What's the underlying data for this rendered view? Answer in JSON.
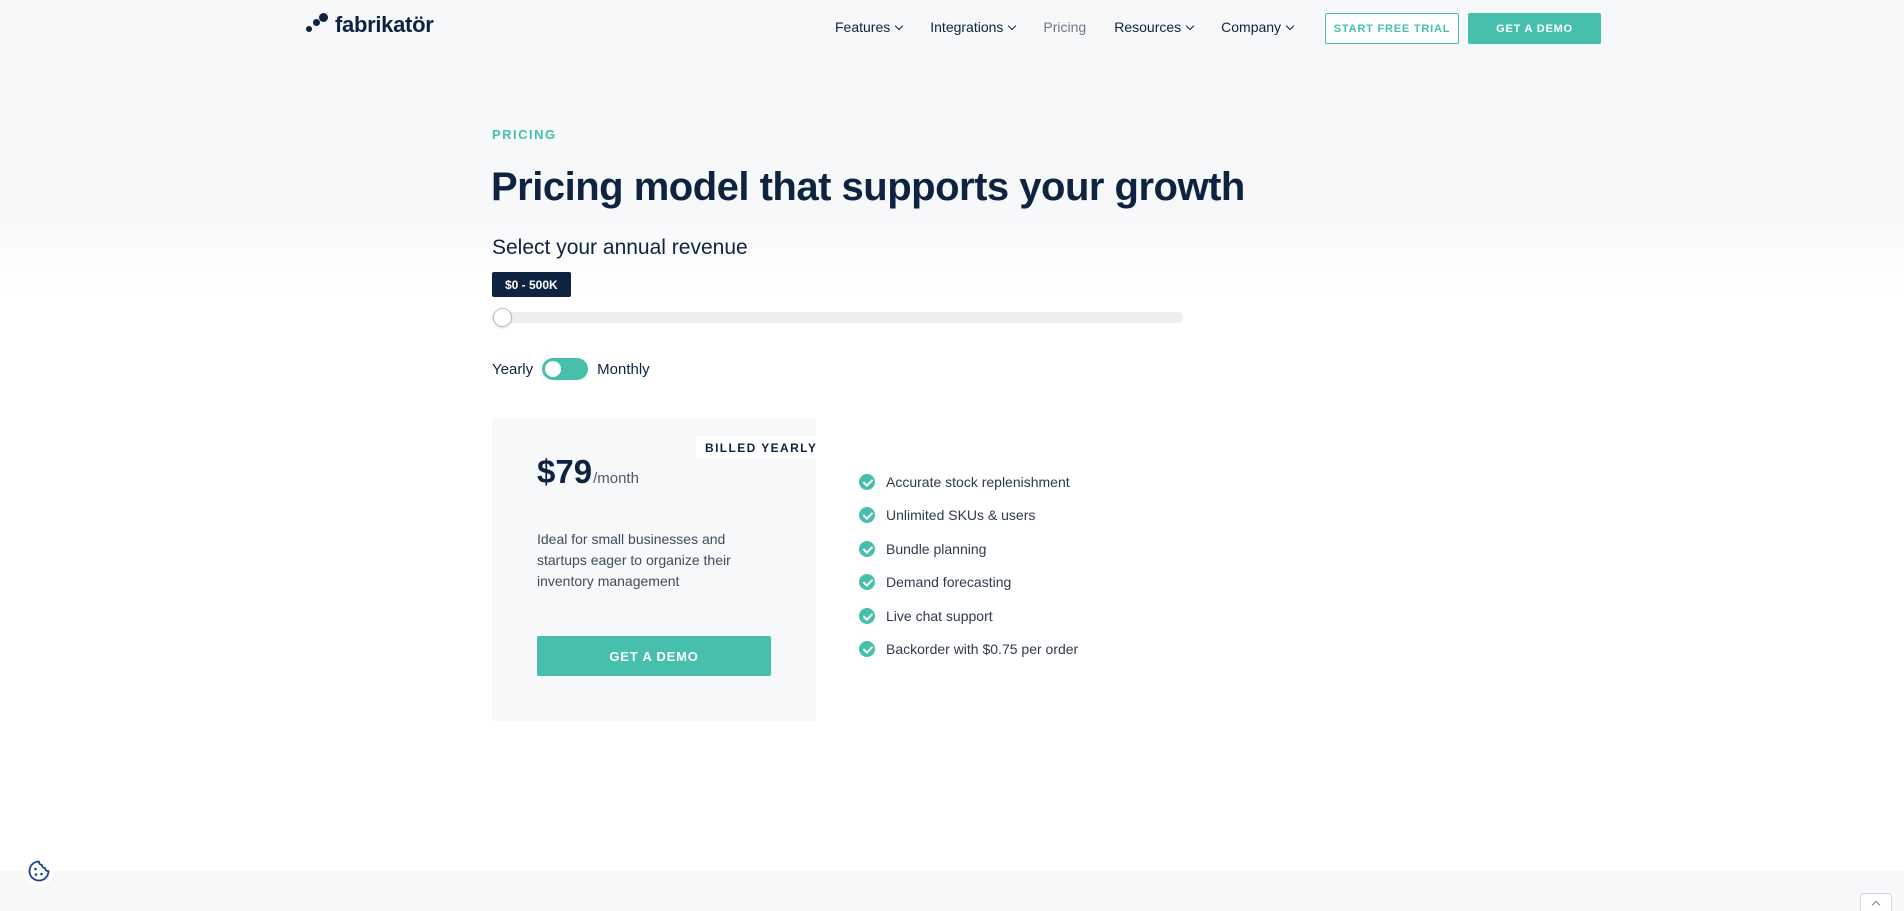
{
  "header": {
    "logo_text": "fabrikatör",
    "nav": [
      {
        "label": "Features",
        "has_dropdown": true
      },
      {
        "label": "Integrations",
        "has_dropdown": true
      },
      {
        "label": "Pricing",
        "has_dropdown": false
      },
      {
        "label": "Resources",
        "has_dropdown": true
      },
      {
        "label": "Company",
        "has_dropdown": true
      }
    ],
    "trial_label": "START FREE TRIAL",
    "demo_label": "GET A DEMO"
  },
  "hero": {
    "eyebrow": "PRICING",
    "title": "Pricing model that supports your growth",
    "subtitle": "Select your annual revenue",
    "revenue_value": "$0 - 500K",
    "slider_position": 0
  },
  "billing": {
    "yearly_label": "Yearly",
    "monthly_label": "Monthly"
  },
  "card": {
    "billed_tag": "BILLED YEARLY",
    "price": "$79",
    "period": "/month",
    "description": "Ideal for small businesses and startups eager to organize their inventory management",
    "button_label": "GET A DEMO"
  },
  "features": [
    "Accurate stock replenishment",
    "Unlimited SKUs & users",
    "Bundle planning",
    "Demand forecasting",
    "Live chat support",
    "Backorder with $0.75 per order"
  ],
  "colors": {
    "brand_navy": "#0e2340",
    "accent_teal": "#46c0ad"
  },
  "icons": {
    "cookie": "cookie-icon",
    "check": "check-icon",
    "scroll_top": "chevron-up-icon"
  }
}
